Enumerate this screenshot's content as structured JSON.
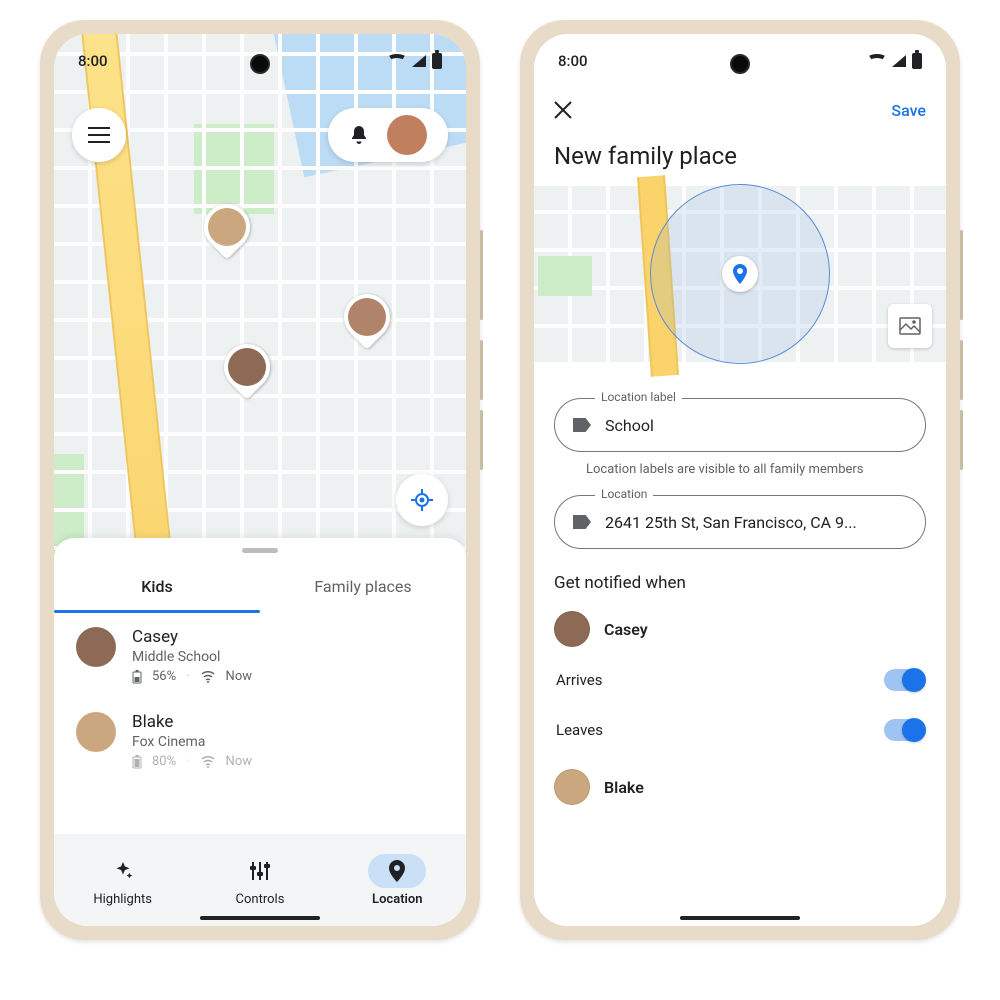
{
  "status": {
    "time": "8:00"
  },
  "left": {
    "tabs": {
      "kids": "Kids",
      "family_places": "Family places"
    },
    "kids": [
      {
        "name": "Casey",
        "place": "Middle School",
        "battery": "56%",
        "signal_time": "Now"
      },
      {
        "name": "Blake",
        "place": "Fox Cinema",
        "battery": "80%",
        "signal_time": "Now"
      }
    ],
    "nav": {
      "highlights": "Highlights",
      "controls": "Controls",
      "location": "Location"
    }
  },
  "right": {
    "save": "Save",
    "title": "New family place",
    "fields": {
      "label_legend": "Location label",
      "label_value": "School",
      "label_hint": "Location labels are visible to all family members",
      "location_legend": "Location",
      "location_value": "2641 25th St, San Francisco, CA 9..."
    },
    "notify": {
      "header": "Get notified when",
      "people": [
        {
          "name": "Casey",
          "toggles": [
            {
              "label": "Arrives",
              "on": true
            },
            {
              "label": "Leaves",
              "on": true
            }
          ]
        },
        {
          "name": "Blake",
          "toggles": []
        }
      ]
    }
  }
}
